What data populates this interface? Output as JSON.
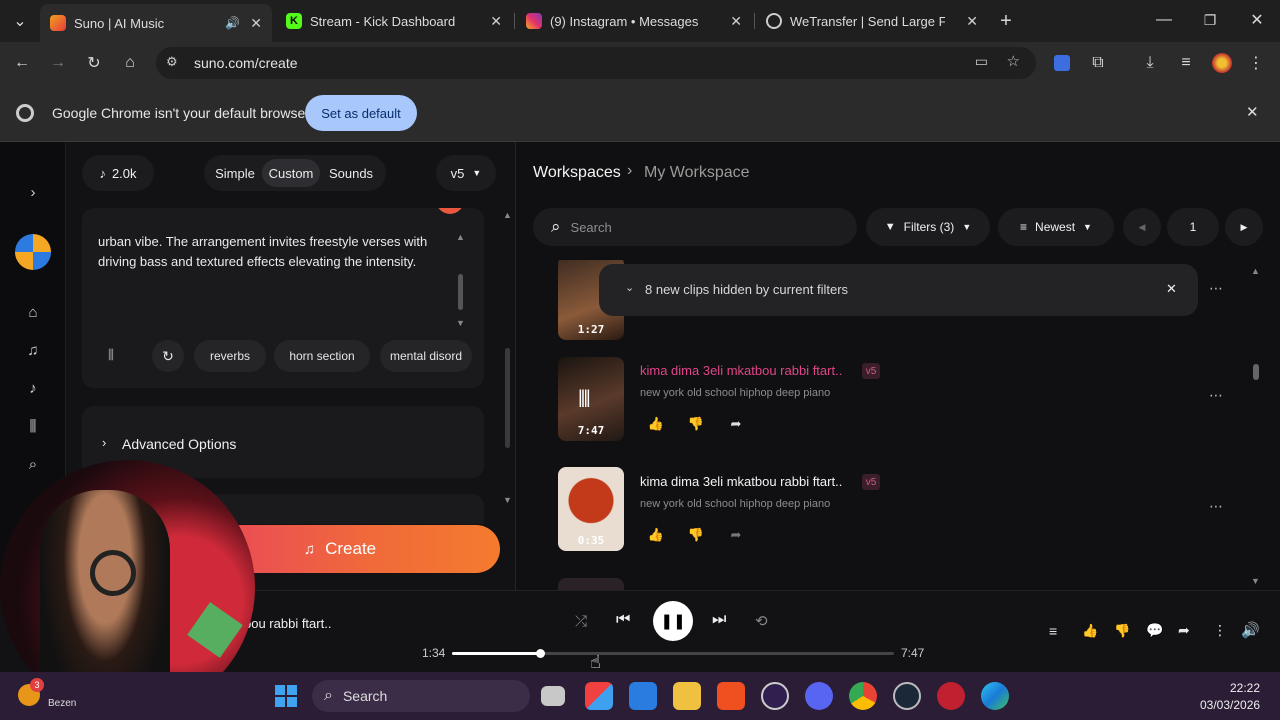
{
  "browser": {
    "tabs": [
      {
        "title": "Suno | AI Music",
        "active": true
      },
      {
        "title": "Stream - Kick Dashboard",
        "active": false
      },
      {
        "title": "(9) Instagram • Messages",
        "active": false
      },
      {
        "title": "WeTransfer | Send Large Files Fa",
        "active": false
      }
    ],
    "url": "suno.com/create",
    "infobar": {
      "message": "Google Chrome isn't your default browser",
      "button": "Set as default"
    }
  },
  "left": {
    "credits": "2.0k",
    "modes": [
      "Simple",
      "Custom",
      "Sounds"
    ],
    "active_mode": "Custom",
    "model": "v5",
    "style_text": "urban vibe. The arrangement invites freestyle verses with driving bass and textured effects elevating the intensity.",
    "chips": [
      "reverbs",
      "horn section",
      "mental disord"
    ],
    "advanced": "Advanced Options",
    "create": "Create"
  },
  "right": {
    "breadcrumb": {
      "root": "Workspaces",
      "current": "My Workspace"
    },
    "search_placeholder": "Search",
    "filters": "Filters (3)",
    "sort": "Newest",
    "page": "1",
    "hidden_notice": "8 new clips hidden by current filters",
    "clips": [
      {
        "duration": "1:27"
      },
      {
        "title": "kima dima 3eli mkatbou rabbi ftart..",
        "subtitle": "new york old school hiphop deep piano",
        "badge": "v5",
        "duration": "7:47",
        "playing": true
      },
      {
        "title": "kima dima 3eli mkatbou rabbi ftart..",
        "subtitle": "new york old school hiphop deep piano",
        "badge": "v5",
        "duration": "0:35",
        "playing": false
      }
    ]
  },
  "player": {
    "now_playing": "bou rabbi ftart..",
    "elapsed": "1:34",
    "total": "7:47",
    "progress_fraction": 0.2
  },
  "taskbar": {
    "search": "Search",
    "time": "22:22",
    "date": "03/03/2026",
    "weather_label": "Bezen",
    "weather_badge": "3"
  },
  "colors": {
    "accent_pink": "#e0458a",
    "create_gradient_start": "#e8425e",
    "create_gradient_end": "#f47b2e",
    "chrome_button": "#a8c7fa"
  }
}
